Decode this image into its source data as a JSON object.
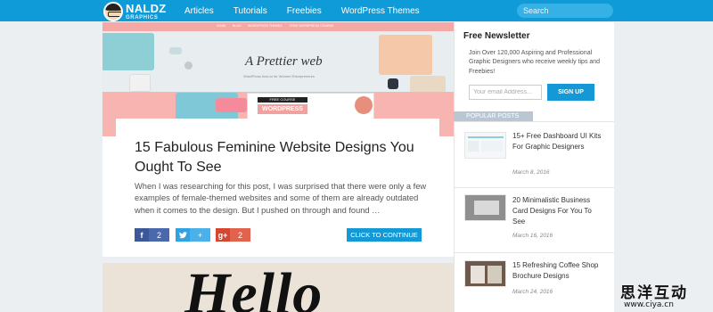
{
  "header": {
    "logo_main": "NALDZ",
    "logo_sub": "GRAPHICS",
    "nav": [
      "Articles",
      "Tutorials",
      "Freebies",
      "WordPress Themes"
    ],
    "search_placeholder": "Search"
  },
  "hero": {
    "strip_links": [
      "HOME",
      "BLOG",
      "WORDPRESS THEMES",
      "FREE WORDPRESS COURSE"
    ],
    "title": "A Prettier web",
    "subtitle": "WordPress how-to for Women Entrepreneurs",
    "course_label": "FREE COURSE",
    "wp_label": "WORDPRESS"
  },
  "post": {
    "title": "15 Fabulous Feminine Website Designs You Ought To See",
    "excerpt": "When I was researching for this post, I was surprised that there were only a few examples of female-themed websites and some of them are already outdated when it comes to the design. But I pushed on through and found …",
    "share": {
      "facebook": {
        "icon": "f",
        "count": "2"
      },
      "twitter": {
        "icon": "♥",
        "count": "+"
      },
      "googleplus": {
        "icon": "g+",
        "count": "2"
      }
    },
    "continue_label": "CLICK TO CONTINUE"
  },
  "post2": {
    "image_text": "Hello"
  },
  "sidebar": {
    "newsletter_title": "Free Newsletter",
    "newsletter_text": "Join Over 120,000 Aspiring and Professional Graphic Designers who receive weekly tips and Freebies!",
    "email_placeholder": "Your email Address...",
    "signup_label": "SIGN UP",
    "popular_label": "POPULAR POSTS",
    "popular": [
      {
        "title": "15+ Free Dashboard UI Kits For Graphic Designers",
        "date": "March 8, 2016"
      },
      {
        "title": "20 Minimalistic Business Card Designs For You To See",
        "date": "March 16, 2016"
      },
      {
        "title": "15 Refreshing Coffee Shop Brochure Designs",
        "date": "March 24, 2016"
      }
    ]
  },
  "watermark": {
    "chinese": "思洋互动",
    "url": "www.ciya.cn"
  },
  "colors": {
    "header": "#0e9bd8",
    "accent": "#1499d6",
    "pink": "#f7b4b1",
    "facebook": "#3b5998",
    "twitter": "#2fa3e3",
    "googleplus": "#d5482f"
  }
}
